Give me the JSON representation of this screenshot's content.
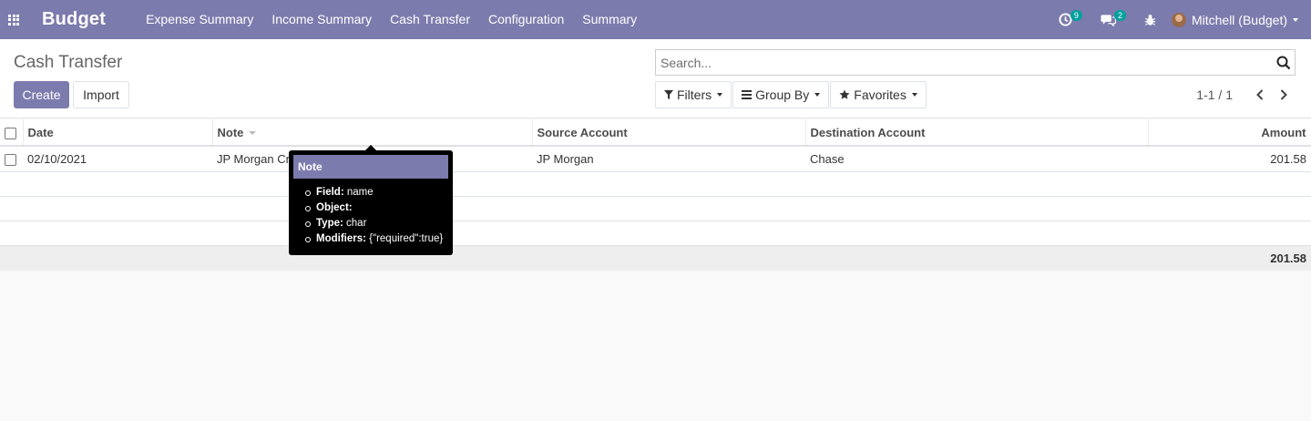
{
  "navbar": {
    "brand": "Budget",
    "menu": [
      "Expense Summary",
      "Income Summary",
      "Cash Transfer",
      "Configuration",
      "Summary"
    ],
    "activity_count": "9",
    "message_count": "2",
    "user_name": "Mitchell (Budget)",
    "background": "#7c7bad"
  },
  "control_panel": {
    "breadcrumb": "Cash Transfer",
    "create_label": "Create",
    "import_label": "Import",
    "search_placeholder": "Search...",
    "filters_label": "Filters",
    "groupby_label": "Group By",
    "favorites_label": "Favorites",
    "pager": "1-1 / 1"
  },
  "table": {
    "columns": [
      "Date",
      "Note",
      "Source Account",
      "Destination Account",
      "Amount"
    ],
    "rows": [
      {
        "date": "02/10/2021",
        "note": "JP Morgan Cr",
        "source": "JP Morgan",
        "destination": "Chase",
        "amount": "201.58"
      }
    ],
    "total_amount": "201.58"
  },
  "tooltip": {
    "title": "Note",
    "items": [
      {
        "key": "Field:",
        "value": "name"
      },
      {
        "key": "Object:",
        "value": ""
      },
      {
        "key": "Type:",
        "value": "char"
      },
      {
        "key": "Modifiers:",
        "value": "{\"required\":true}"
      }
    ]
  }
}
